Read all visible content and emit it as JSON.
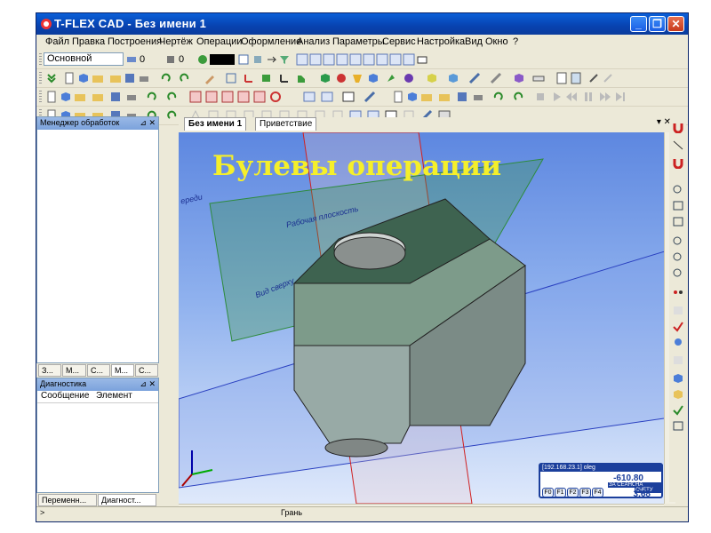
{
  "window": {
    "title": "T-FLEX CAD - Без имени 1",
    "controls": {
      "minimize": "_",
      "maximize": "❐",
      "close": "✕"
    }
  },
  "menu": [
    "Файл",
    "Правка",
    "Построения",
    "Чертёж",
    "Операции",
    "Оформление",
    "Анализ",
    "Параметры",
    "Сервис",
    "Настройка",
    "Вид",
    "Окно",
    "?"
  ],
  "toolbar": {
    "layer_label": "Основной",
    "field1": "0",
    "field2": "0"
  },
  "left_panels": {
    "top": {
      "title": "Менеджер обработок",
      "tabs": [
        "З...",
        "М...",
        "С...",
        "М...",
        "С..."
      ]
    },
    "bottom": {
      "title": "Диагностика",
      "columns": [
        "Сообщение",
        "Элемент"
      ],
      "tabs": [
        "Переменн...",
        "Диагност..."
      ]
    }
  },
  "document_tabs": [
    "Без имени 1",
    "Приветствие"
  ],
  "viewport": {
    "overlay_title": "Булевы операции",
    "plane_labels": [
      "Рабочая плоскость",
      "Вид сверху",
      "ереди"
    ]
  },
  "coord_widget": {
    "header": "[192.168.23.1] oleg",
    "value1": "-610.80",
    "value2": "3.68",
    "small1": "ЗА СЕАНС",
    "small2": "НА СЧЕТУ",
    "fkeys": [
      "F0",
      "F1",
      "F2",
      "F3",
      "F4"
    ]
  },
  "statusbar": {
    "left": ">",
    "center": "Грань"
  },
  "colors": {
    "title_bar": "#0a4fc8",
    "overlay_title": "#f5ef2a",
    "work_plane": "#2e8b3c"
  }
}
